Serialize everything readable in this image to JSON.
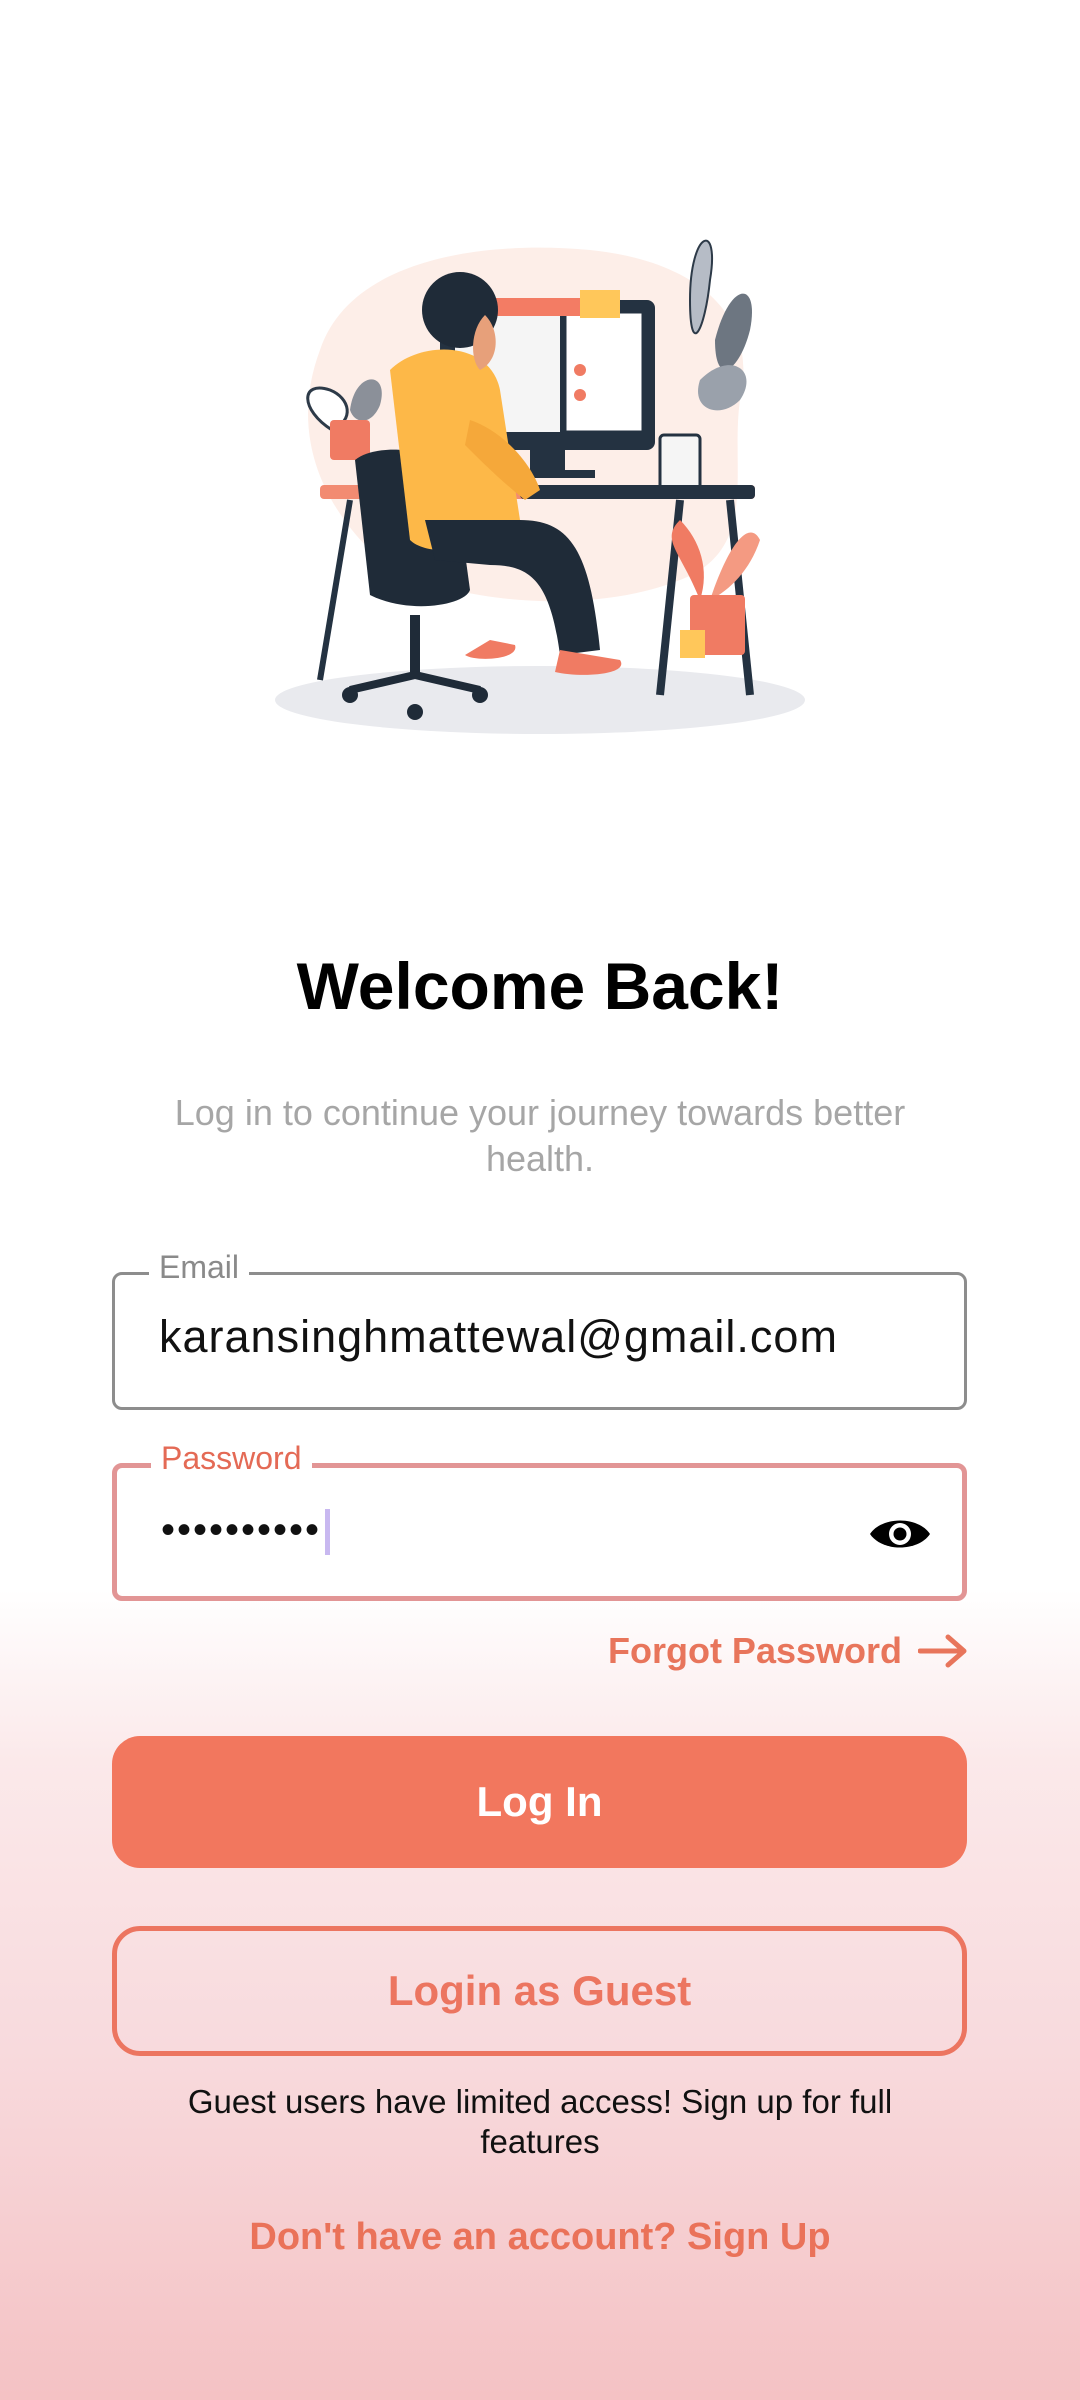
{
  "login": {
    "title": "Welcome Back!",
    "subtitle": "Log in to continue your journey towards better health.",
    "email": {
      "label": "Email",
      "value": "karansinghmattewal@gmail.com"
    },
    "password": {
      "label": "Password",
      "masked_value": "••••••••••",
      "visibility_icon": "eye-icon"
    },
    "forgot_password": "Forgot Password",
    "login_button": "Log In",
    "guest_button": "Login as Guest",
    "guest_note": "Guest users have limited access! Sign up for full features",
    "signup_link": "Don't have an account? Sign Up"
  },
  "colors": {
    "accent": "#f2775e",
    "password_border": "#e29595",
    "subtitle": "#a6a6a6",
    "background_bottom": "#f4c2c4"
  }
}
